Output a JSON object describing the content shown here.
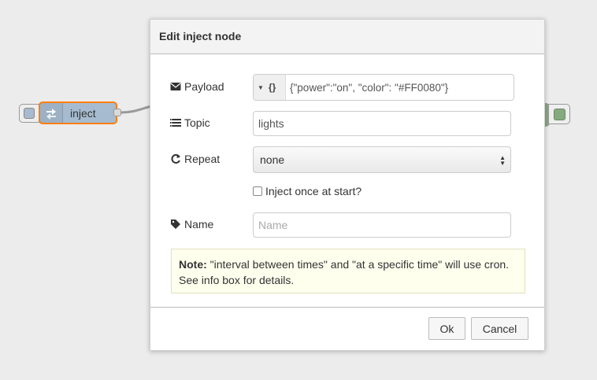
{
  "canvas": {
    "node": {
      "label": "inject",
      "fill": "#a6bbcf",
      "selected_border": "#ff7f0e",
      "icon": "inject-arrow-icon"
    },
    "right_node_color": "#87a980"
  },
  "dialog": {
    "title": "Edit inject node",
    "payload": {
      "label": "Payload",
      "type_symbol": "{}",
      "value": "{\"power\":\"on\", \"color\": \"#FF0080\"}",
      "icon": "envelope-icon"
    },
    "topic": {
      "label": "Topic",
      "value": "lights",
      "icon": "list-icon"
    },
    "repeat": {
      "label": "Repeat",
      "selected": "none",
      "icon": "refresh-icon"
    },
    "inject_once": {
      "label": "Inject once at start?",
      "checked": false
    },
    "name": {
      "label": "Name",
      "placeholder": "Name",
      "value": "",
      "icon": "tag-icon"
    },
    "note": {
      "bold": "Note:",
      "text": " \"interval between times\" and \"at a specific time\" will use cron. See info box for details."
    },
    "buttons": {
      "ok": "Ok",
      "cancel": "Cancel"
    }
  }
}
